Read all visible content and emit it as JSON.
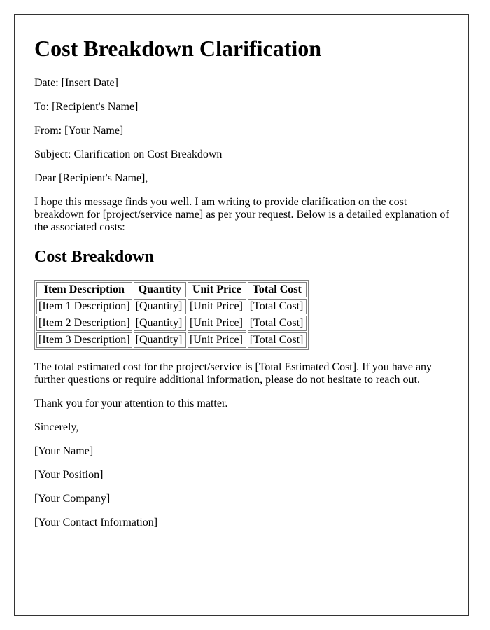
{
  "title": "Cost Breakdown Clarification",
  "header_fields": {
    "date": "Date: [Insert Date]",
    "to": "To: [Recipient's Name]",
    "from": "From: [Your Name]",
    "subject": "Subject: Clarification on Cost Breakdown"
  },
  "salutation": "Dear [Recipient's Name],",
  "intro": "I hope this message finds you well. I am writing to provide clarification on the cost breakdown for [project/service name] as per your request. Below is a detailed explanation of the associated costs:",
  "section_heading": "Cost Breakdown",
  "table": {
    "headers": [
      "Item Description",
      "Quantity",
      "Unit Price",
      "Total Cost"
    ],
    "rows": [
      [
        "[Item 1 Description]",
        "[Quantity]",
        "[Unit Price]",
        "[Total Cost]"
      ],
      [
        "[Item 2 Description]",
        "[Quantity]",
        "[Unit Price]",
        "[Total Cost]"
      ],
      [
        "[Item 3 Description]",
        "[Quantity]",
        "[Unit Price]",
        "[Total Cost]"
      ]
    ]
  },
  "summary": "The total estimated cost for the project/service is [Total Estimated Cost]. If you have any further questions or require additional information, please do not hesitate to reach out.",
  "thanks": "Thank you for your attention to this matter.",
  "closing": "Sincerely,",
  "signature": {
    "name": "[Your Name]",
    "position": "[Your Position]",
    "company": "[Your Company]",
    "contact": "[Your Contact Information]"
  }
}
